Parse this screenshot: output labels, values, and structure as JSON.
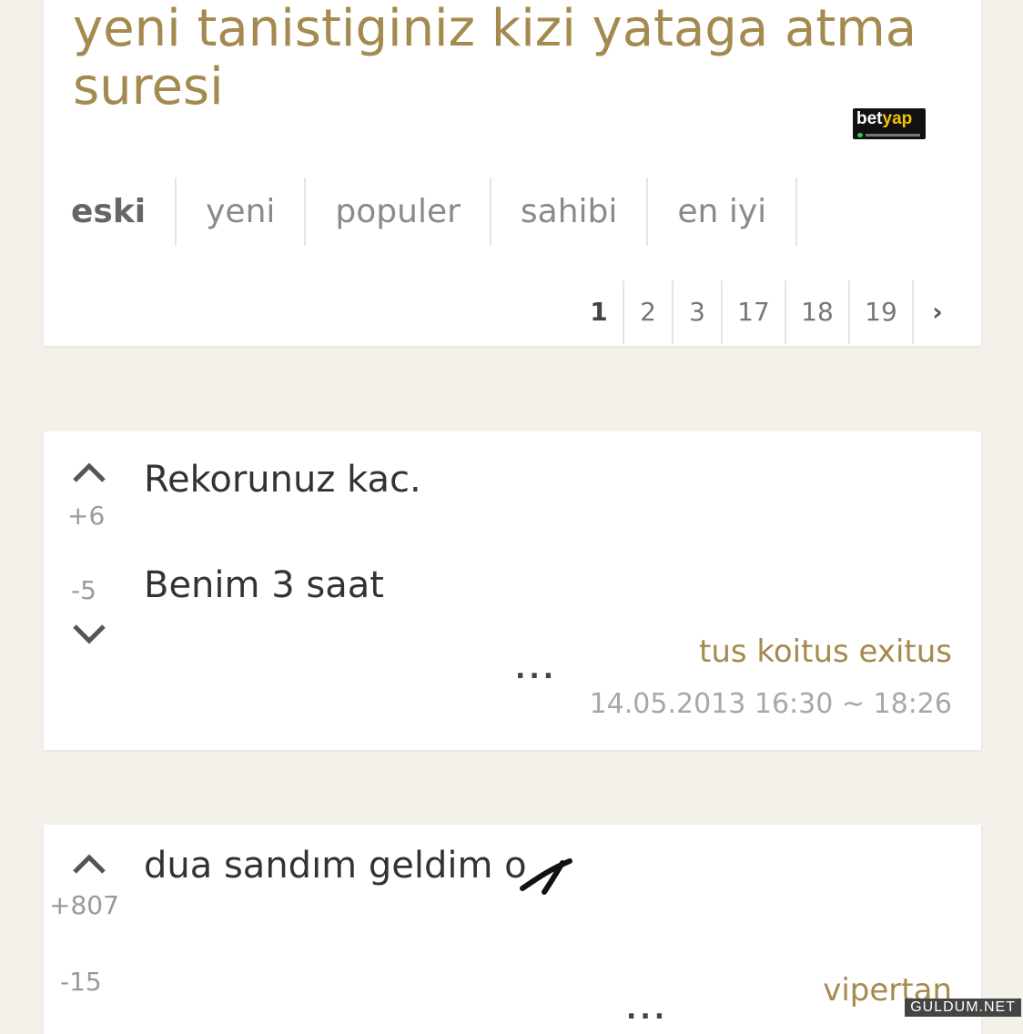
{
  "topic": {
    "title": "yeni tanistiginiz kizi yataga atma suresi"
  },
  "tabs": [
    "eski",
    "yeni",
    "populer",
    "sahibi",
    "en iyi"
  ],
  "pagination": [
    "1",
    "2",
    "3",
    "17",
    "18",
    "19",
    "›"
  ],
  "entries": [
    {
      "text_line1": "Rekorunuz kac.",
      "text_line2": "Benim 3 saat",
      "up_score": "+6",
      "down_score": "-5",
      "author": "tus koitus exitus",
      "date": "14.05.2013 16:30 ~ 18:26",
      "more": "..."
    },
    {
      "text_line1": "dua sandım geldim o",
      "up_score": "+807",
      "down_score": "-15",
      "author": "vipertan",
      "more": "..."
    }
  ],
  "logo": {
    "brand_a": "bet",
    "brand_b": "yap"
  },
  "watermark": "GULDUM.NET",
  "colors": {
    "title": "#a48a4e",
    "background": "#f3f1e9"
  }
}
